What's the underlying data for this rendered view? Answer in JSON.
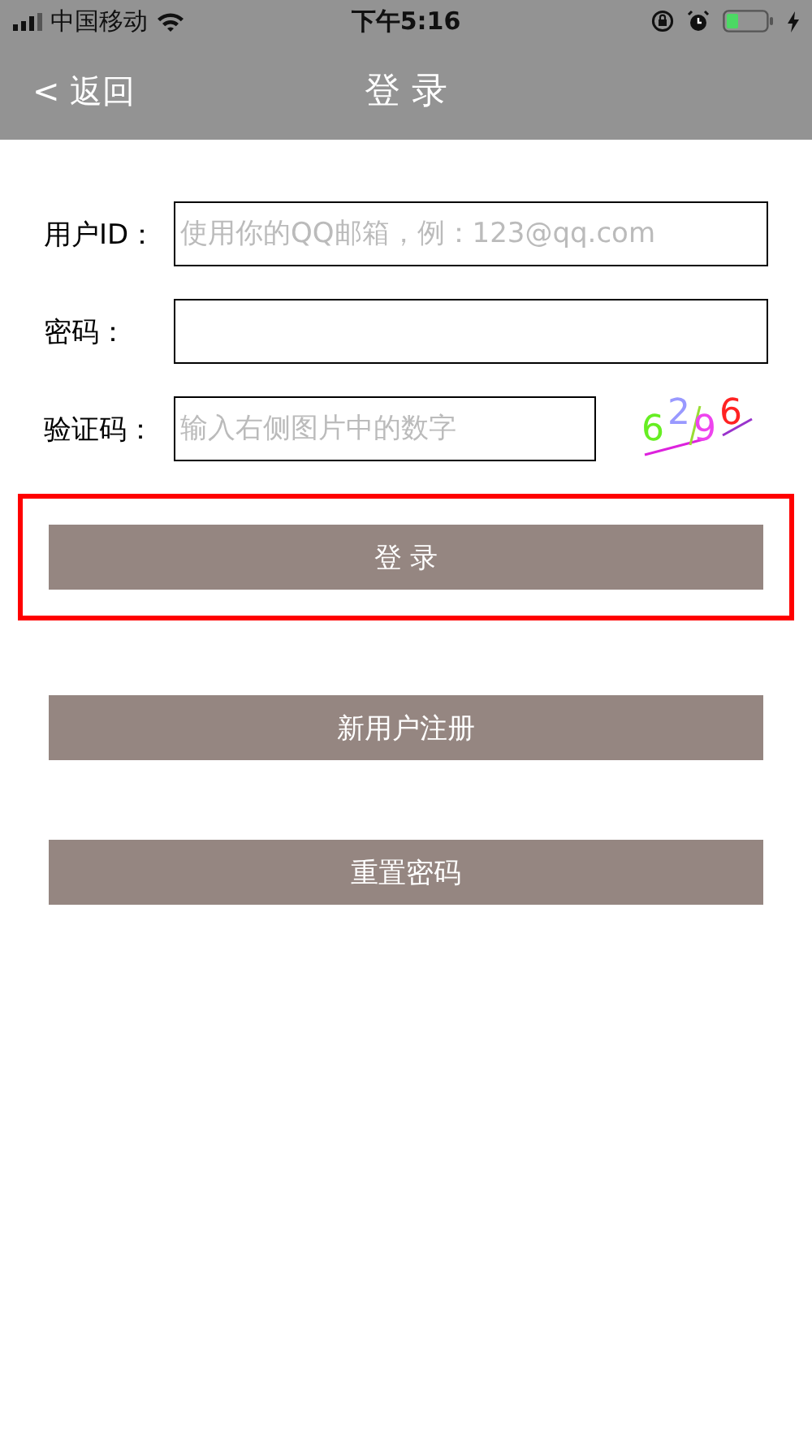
{
  "status_bar": {
    "carrier": "中国移动",
    "time": "下午5:16"
  },
  "nav_bar": {
    "back": "< 返回",
    "title": "登 录"
  },
  "fields": [
    {
      "label": "用户ID：",
      "placeholder": "使用你的QQ邮箱，例：123@qq.com",
      "kind": "text"
    },
    {
      "label": "密码：",
      "kind": "password"
    },
    {
      "label": "验证码：",
      "placeholder": "输入右侧图片中的数字",
      "kind": "captcha"
    }
  ],
  "captcha": {
    "digits": [
      {
        "text": "6",
        "color": "#66ee22"
      },
      {
        "text": "2",
        "color": "#9999ff"
      },
      {
        "text": "9",
        "color": "#ee44ee"
      },
      {
        "text": "6",
        "color": "#ff2222"
      }
    ]
  },
  "buttons": [
    {
      "label": "登 录",
      "highlighted": true
    },
    {
      "label": "新用户注册",
      "highlighted": false
    },
    {
      "label": "重置密码",
      "highlighted": false
    }
  ]
}
